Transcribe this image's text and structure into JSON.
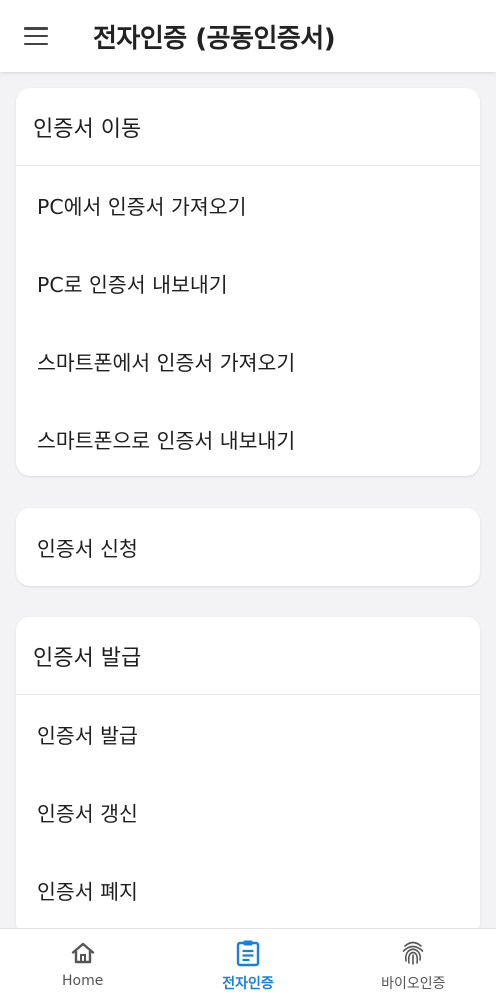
{
  "appbar": {
    "title": "전자인증 (공동인증서)",
    "menu_icon": "hamburger-menu-icon"
  },
  "sections": {
    "transfer": {
      "header": "인증서 이동",
      "items": [
        "PC에서 인증서 가져오기",
        "PC로 인증서 내보내기",
        "스마트폰에서 인증서 가져오기",
        "스마트폰으로 인증서 내보내기"
      ]
    },
    "apply": {
      "label": "인증서 신청"
    },
    "issue": {
      "header": "인증서 발급",
      "items": [
        "인증서 발급",
        "인증서 갱신",
        "인증서 폐지"
      ]
    }
  },
  "bottom_nav": {
    "items": [
      {
        "label": "Home",
        "icon": "home-icon",
        "active": false
      },
      {
        "label": "전자인증",
        "icon": "clipboard-icon",
        "active": true
      },
      {
        "label": "바이오인증",
        "icon": "fingerprint-icon",
        "active": false
      }
    ]
  },
  "colors": {
    "accent": "#1b7fd6",
    "background": "#f3f2f5",
    "card": "#ffffff"
  }
}
